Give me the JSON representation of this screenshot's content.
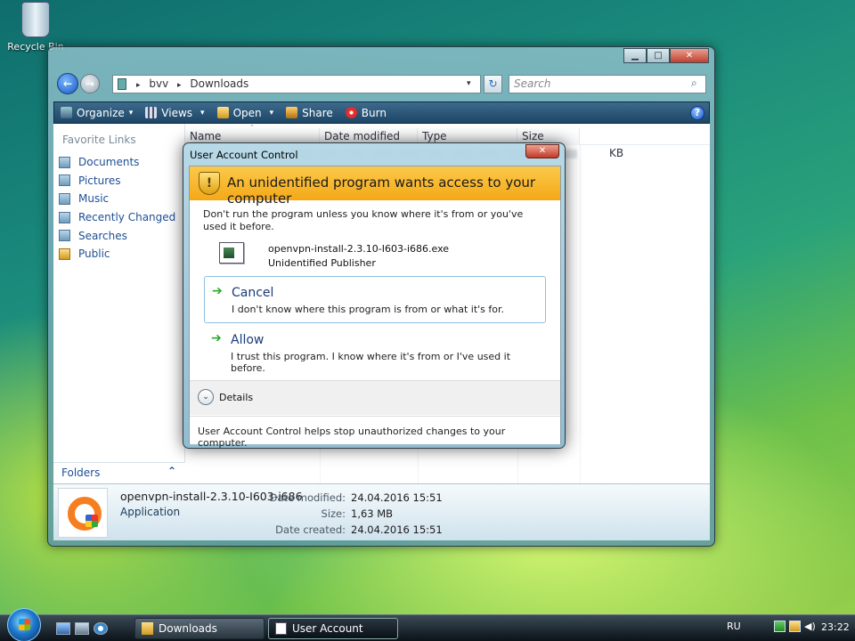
{
  "desktop": {
    "recycle_bin_label": "Recycle Bin"
  },
  "explorer": {
    "breadcrumb": [
      "bvv",
      "Downloads"
    ],
    "search_placeholder": "Search",
    "toolbar": {
      "organize": "Organize",
      "views": "Views",
      "open": "Open",
      "share": "Share",
      "burn": "Burn"
    },
    "favorite_links_title": "Favorite Links",
    "favorite_links": [
      "Documents",
      "Pictures",
      "Music",
      "Recently Changed",
      "Searches",
      "Public"
    ],
    "folders_label": "Folders",
    "columns": [
      "Name",
      "Date modified",
      "Type",
      "Size"
    ],
    "size_fragment": "KB",
    "details": {
      "file_name": "openvpn-install-2.3.10-I603-i686",
      "file_type": "Application",
      "date_modified_label": "Date modified:",
      "date_modified": "24.04.2016 15:51",
      "size_label": "Size:",
      "size": "1,63 MB",
      "date_created_label": "Date created:",
      "date_created": "24.04.2016 15:51"
    }
  },
  "uac": {
    "title": "User Account Control",
    "banner": "An unidentified program wants access to your computer",
    "warning": "Don't run the program unless you know where it's from or you've used it before.",
    "program_name": "openvpn-install-2.3.10-I603-i686.exe",
    "publisher": "Unidentified Publisher",
    "cancel_title": "Cancel",
    "cancel_desc": "I don't know where this program is from or what it's for.",
    "allow_title": "Allow",
    "allow_desc": "I trust this program. I know where it's from or I've used it before.",
    "details_label": "Details",
    "footer": "User Account Control helps stop unauthorized changes to your computer."
  },
  "taskbar": {
    "task_downloads": "Downloads",
    "task_uac": "User Account Control",
    "language": "RU",
    "clock": "23:22"
  },
  "icons": {
    "nav_back": "←",
    "nav_forward": "→",
    "breadcrumb_sep": "▸",
    "dropdown": "▾",
    "refresh": "↻",
    "search": "⌕",
    "help": "?",
    "sort": "⌃",
    "collapse": "⌃",
    "minimize": "▁",
    "maximize": "□",
    "close": "✕",
    "arrow_right": "➔",
    "expand": "⌄"
  }
}
